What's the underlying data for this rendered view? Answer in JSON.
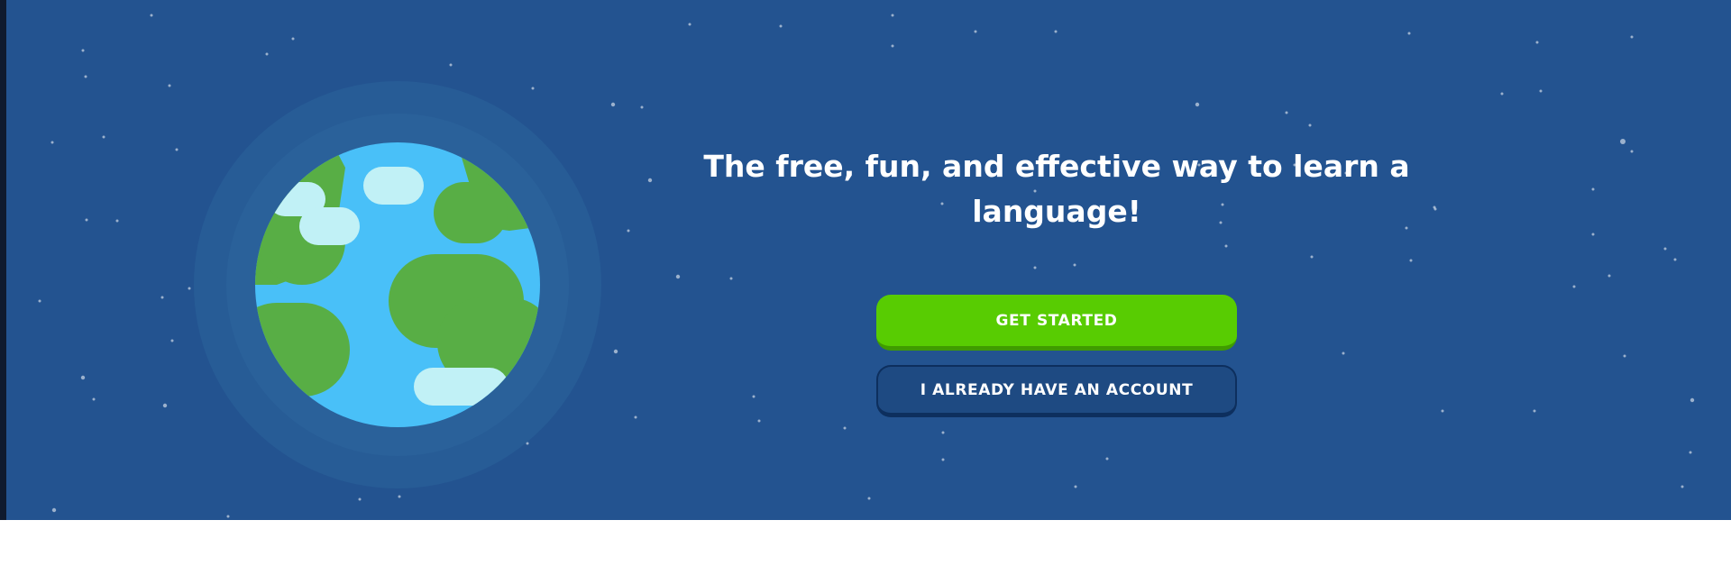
{
  "hero": {
    "headline": "The free, fun, and effective way to learn a language!",
    "get_started_label": "GET STARTED",
    "have_account_label": "I ALREADY HAVE AN ACCOUNT"
  },
  "illustration": {
    "globe_icon": "earth-globe-illustration"
  },
  "colors": {
    "background": "#235390",
    "primary_button": "#58cc02",
    "ocean": "#49c0f8",
    "land": "#58ae45",
    "cloud": "#c1f1f6"
  }
}
